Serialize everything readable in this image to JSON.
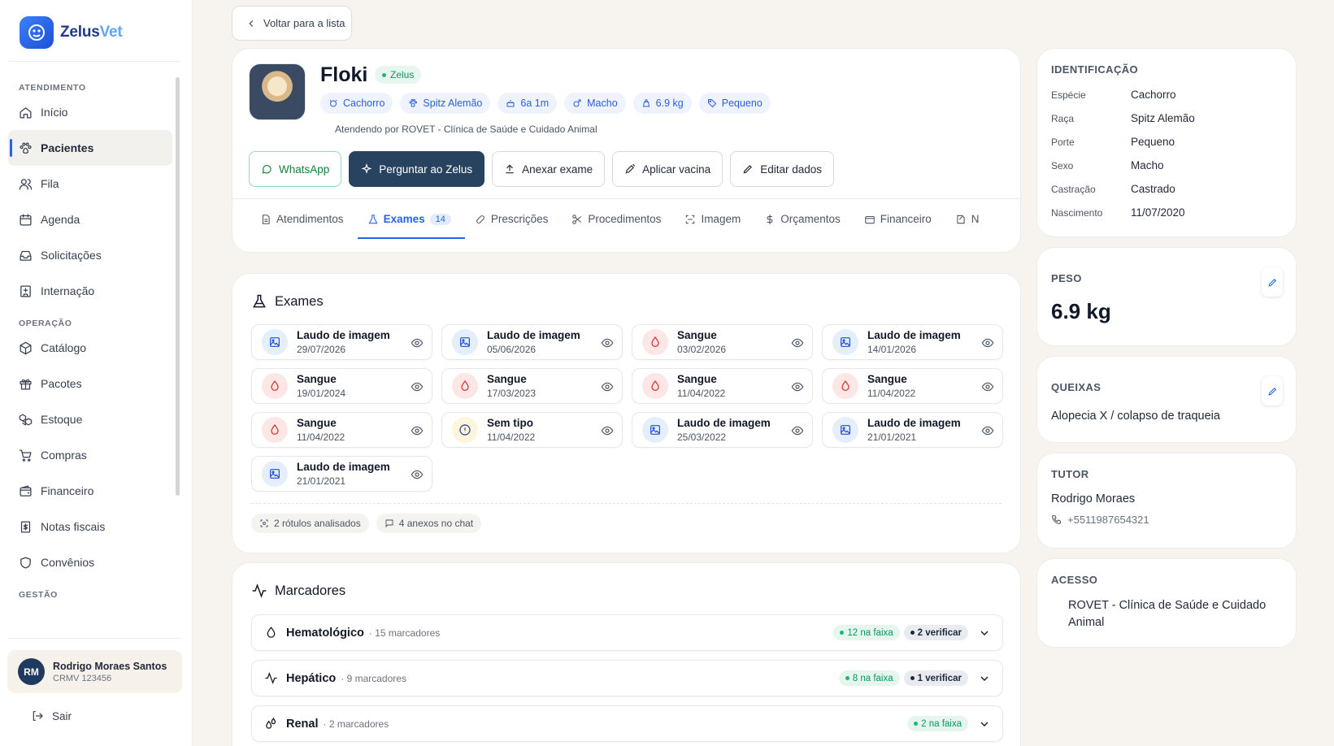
{
  "app": {
    "name_part1": "Zelus",
    "name_part2": "Vet"
  },
  "sidebar": {
    "sections": [
      {
        "label": "ATENDIMENTO"
      },
      {
        "label": "OPERAÇÃO"
      },
      {
        "label": "GESTÃO"
      }
    ],
    "items": [
      {
        "label": "Início",
        "icon": "home-icon"
      },
      {
        "label": "Pacientes",
        "icon": "paw-icon"
      },
      {
        "label": "Fila",
        "icon": "users-icon"
      },
      {
        "label": "Agenda",
        "icon": "calendar-icon"
      },
      {
        "label": "Solicitações",
        "icon": "inbox-icon"
      },
      {
        "label": "Internação",
        "icon": "hospital-icon"
      },
      {
        "label": "Catálogo",
        "icon": "box-icon"
      },
      {
        "label": "Pacotes",
        "icon": "gift-icon"
      },
      {
        "label": "Estoque",
        "icon": "boxes-icon"
      },
      {
        "label": "Compras",
        "icon": "cart-icon"
      },
      {
        "label": "Financeiro",
        "icon": "wallet-icon"
      },
      {
        "label": "Notas fiscais",
        "icon": "receipt-icon"
      },
      {
        "label": "Convênios",
        "icon": "shield-icon"
      }
    ],
    "user": {
      "initials": "RM",
      "name": "Rodrigo Moraes Santos",
      "crm": "CRMV 123456"
    },
    "logout_label": "Sair"
  },
  "back_label": "Voltar para a lista",
  "patient": {
    "name": "Floki",
    "badge": "Zelus",
    "chips": [
      {
        "label": "Cachorro",
        "icon": "dog-icon"
      },
      {
        "label": "Spitz Alemão",
        "icon": "paw-icon"
      },
      {
        "label": "6a 1m",
        "icon": "cake-icon"
      },
      {
        "label": "Macho",
        "icon": "male-icon"
      },
      {
        "label": "6.9 kg",
        "icon": "weight-icon"
      },
      {
        "label": "Pequeno",
        "icon": "tag-icon"
      }
    ],
    "attending": "Atendendo por ROVET - Clínica de Saúde e Cuidado Animal",
    "actions": {
      "whatsapp": "WhatsApp",
      "ask": "Perguntar ao Zelus",
      "attach": "Anexar exame",
      "vaccine": "Aplicar vacina",
      "edit": "Editar dados"
    },
    "tabs": [
      {
        "label": "Atendimentos",
        "icon": "doc-icon"
      },
      {
        "label": "Exames",
        "icon": "flask-icon",
        "count": "14"
      },
      {
        "label": "Prescrições",
        "icon": "pill-icon"
      },
      {
        "label": "Procedimentos",
        "icon": "scissors-icon"
      },
      {
        "label": "Imagem",
        "icon": "scan-icon"
      },
      {
        "label": "Orçamentos",
        "icon": "dollar-icon"
      },
      {
        "label": "Financeiro",
        "icon": "wallet-icon"
      },
      {
        "label": "N",
        "icon": "note-icon"
      }
    ]
  },
  "exams": {
    "title": "Exames",
    "items": [
      {
        "title": "Laudo de imagem",
        "date": "29/07/2026",
        "type": "img"
      },
      {
        "title": "Laudo de imagem",
        "date": "05/06/2026",
        "type": "img"
      },
      {
        "title": "Sangue",
        "date": "03/02/2026",
        "type": "blood"
      },
      {
        "title": "Laudo de imagem",
        "date": "14/01/2026",
        "type": "img"
      },
      {
        "title": "Sangue",
        "date": "19/01/2024",
        "type": "blood"
      },
      {
        "title": "Sangue",
        "date": "17/03/2023",
        "type": "blood"
      },
      {
        "title": "Sangue",
        "date": "11/04/2022",
        "type": "blood"
      },
      {
        "title": "Sangue",
        "date": "11/04/2022",
        "type": "blood"
      },
      {
        "title": "Sangue",
        "date": "11/04/2022",
        "type": "blood"
      },
      {
        "title": "Sem tipo",
        "date": "11/04/2022",
        "type": "none"
      },
      {
        "title": "Laudo de imagem",
        "date": "25/03/2022",
        "type": "img"
      },
      {
        "title": "Laudo de imagem",
        "date": "21/01/2021",
        "type": "img"
      },
      {
        "title": "Laudo de imagem",
        "date": "21/01/2021",
        "type": "img"
      }
    ],
    "meta_labels": "2 rótulos analisados",
    "meta_attachments": "4 anexos no chat"
  },
  "markers": {
    "title": "Marcadores",
    "groups": [
      {
        "name": "Hematológico",
        "count": "· 15 marcadores",
        "ok": "12 na faixa",
        "check": "2 verificar",
        "icon": "drop-icon"
      },
      {
        "name": "Hepático",
        "count": "· 9 marcadores",
        "ok": "8 na faixa",
        "check": "1 verificar",
        "icon": "pulse-icon"
      },
      {
        "name": "Renal",
        "count": "· 2 marcadores",
        "ok": "2 na faixa",
        "check": "",
        "icon": "drops-icon"
      }
    ]
  },
  "identification": {
    "title": "IDENTIFICAÇÃO",
    "rows": [
      {
        "k": "Espécie",
        "v": "Cachorro"
      },
      {
        "k": "Raça",
        "v": "Spitz Alemão"
      },
      {
        "k": "Porte",
        "v": "Pequeno"
      },
      {
        "k": "Sexo",
        "v": "Macho"
      },
      {
        "k": "Castração",
        "v": "Castrado"
      },
      {
        "k": "Nascimento",
        "v": "11/07/2020"
      }
    ]
  },
  "weight": {
    "title": "PESO",
    "value": "6.9 kg"
  },
  "complaints": {
    "title": "QUEIXAS",
    "value": "Alopecia X / colapso de traqueia"
  },
  "tutor": {
    "title": "TUTOR",
    "name": "Rodrigo Moraes",
    "phone": "+5511987654321"
  },
  "access": {
    "title": "ACESSO",
    "value": "ROVET - Clínica de Saúde e Cuidado Animal"
  },
  "colors": {
    "accent": "#2563eb",
    "primary_dark": "#27435f",
    "success": "#059669",
    "danger": "#dc2626"
  }
}
